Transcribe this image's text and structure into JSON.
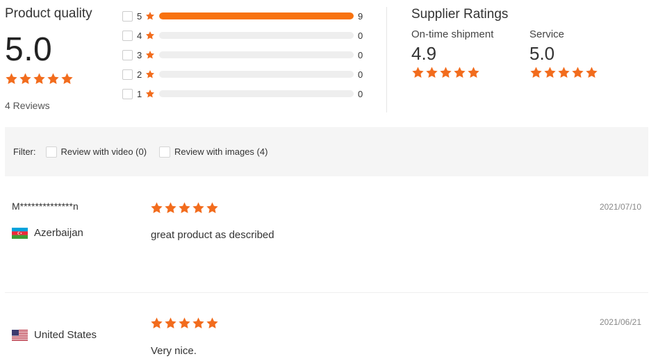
{
  "product_quality": {
    "title": "Product quality",
    "score": "5.0",
    "stars": 5,
    "reviews_label": "4 Reviews"
  },
  "distribution": [
    {
      "stars": "5",
      "count": "9",
      "fill": 1.0
    },
    {
      "stars": "4",
      "count": "0",
      "fill": 0.0
    },
    {
      "stars": "3",
      "count": "0",
      "fill": 0.0
    },
    {
      "stars": "2",
      "count": "0",
      "fill": 0.0
    },
    {
      "stars": "1",
      "count": "0",
      "fill": 0.0
    }
  ],
  "supplier_ratings": {
    "title": "Supplier Ratings",
    "shipment": {
      "label": "On-time shipment",
      "score": "4.9",
      "stars": 5
    },
    "service": {
      "label": "Service",
      "score": "5.0",
      "stars": 5
    }
  },
  "filter": {
    "label": "Filter:",
    "options": [
      "Review with video (0)",
      "Review with images (4)"
    ]
  },
  "reviews": [
    {
      "name": "M**************n",
      "country": "Azerbaijan",
      "flag": "azerbaijan-flag",
      "stars": 5,
      "date": "2021/07/10",
      "text": "great product as described"
    },
    {
      "name": "",
      "country": "United States",
      "flag": "us-flag",
      "stars": 5,
      "date": "2021/06/21",
      "text": "Very nice."
    }
  ],
  "colors": {
    "accent": "#f26c1d",
    "bar_track": "#eeeeee",
    "filter_bg": "#f5f5f5"
  }
}
